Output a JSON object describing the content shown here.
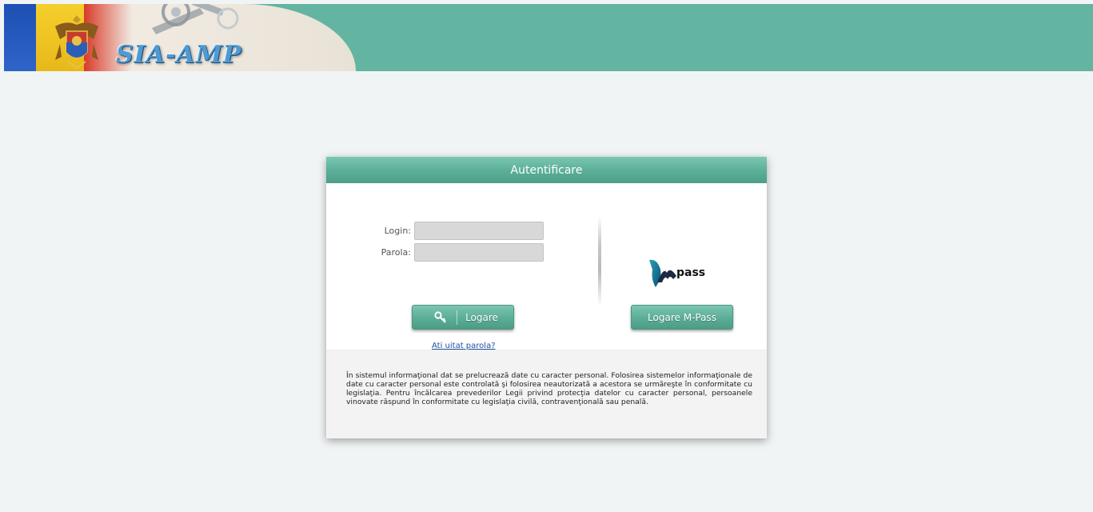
{
  "header": {
    "logo_text": "SIA-AMP",
    "colors": {
      "bar": "#63b4a0",
      "flag_blue": "#1e4fb3",
      "flag_yellow": "#f4d02c",
      "flag_red": "#d93a2a"
    },
    "icons": [
      "coat-of-arms-icon",
      "machinery-graphic"
    ]
  },
  "auth": {
    "title": "Autentificare",
    "login_label": "Login:",
    "login_value": "",
    "password_label": "Parola:",
    "password_value": "",
    "login_button": "Logare",
    "login_button_icon": "key-icon",
    "forgot_link": "Ati uitat parola?",
    "mpass_logo_text": "pass",
    "mpass_button": "Logare M-Pass",
    "notice": "În sistemul informaţional dat se prelucrează date cu caracter personal. Folosirea sistemelor informaţionale de date cu caracter personal este controlată şi folosirea neautorizată a acestora se urmăreşte în conformitate cu legislaţia. Pentru încălcarea prevederilor Legii privind protecţia datelor cu caracter personal, persoanele vinovate răspund în conformitate cu legislaţia civilă, contravenţională sau penală."
  }
}
